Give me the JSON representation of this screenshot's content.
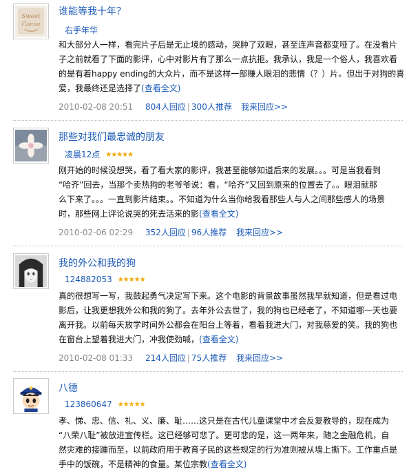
{
  "reviews": [
    {
      "title": "谁能等我十年？",
      "author": "右手年华",
      "stars": "",
      "lines": [
        "和大部分人一样，看完片子后是无止境的感动，哭肿了双眼，甚至连声音都变哑了。在没看片",
        "子之前就看了下面的影评，心中对影片有了那么一点抗拒。我承认，我是一个俗人，我喜欢看",
        "的是有着happy ending的大众片，而不是这样一部赚人眼泪的悲情（？）片。但出于对狗的喜",
        "爱，我最终还是选择了"
      ],
      "more": "(查看全文)",
      "date": "2010-02-08 20:51",
      "replies": "804人回应",
      "recommend": "300人推荐",
      "reply_link": "我来回应>>"
    },
    {
      "title": "那些对我们最忠诚的朋友",
      "author": "凌晨12点",
      "stars": "★★★★★",
      "lines": [
        "刚开始的时候没想哭，看了看大家的影评，我甚至能够知道后来的发展。。。可是当我看到",
        "“哈齐”回去，当那个卖热狗的老爷爷说：看，“哈齐”又回到原来的位置去了。。眼泪就那",
        "么下来了。。。一直到影片结束。。不知道为什么当你给我看那些人与人之间那些感人的场景",
        "时，那些网上评论说哭的死去活来的影"
      ],
      "more": "(查看全文)",
      "date": "2010-02-06 02:29",
      "replies": "352人回应",
      "recommend": "96人推荐",
      "reply_link": "我来回应>>"
    },
    {
      "title": "我的外公和我的狗",
      "author": "124882053",
      "stars": "★★★★★",
      "lines": [
        "真的很想写一写，我鼓起勇气决定写下来。这个电影的背景故事虽然我早就知道，但是看过电",
        "影后，让我更想我外公和我的狗了。去年外公去世了，我的狗也已经老了，不知道哪一天也要",
        "离开我。以前每天放学时间外公都会在阳台上等着，看着我进大门，对我慈爱的笑。我的狗也",
        "在窗台上望着我进大门，冲我使劲喊，"
      ],
      "more": "(查看全文)",
      "date": "2010-02-08 01:33",
      "replies": "214人回应",
      "recommend": "75人推荐",
      "reply_link": "我来回应>>"
    },
    {
      "title": "八德",
      "author": "123860647",
      "stars": "★★★★★",
      "lines": [
        "孝、悌、忠、信、礼、义、廉、耻……这只是在古代儿童课堂中才会反复教导的，现在成为",
        "“八荣八耻”被放进宣传栏。这已经够可悲了。更可悲的是，这一两年来，随之金融危机，自",
        "然灾难的接踵而至，以前政府用于教育子民的这些规定的行为准则被从墙上撕下。工作重点是",
        "手中的饭碗，不是精神的食量。某位宗教"
      ],
      "more": "(查看全文)",
      "date": "",
      "replies": "",
      "recommend": "",
      "reply_link": ""
    }
  ],
  "colors": {
    "link": "#1a59b7",
    "star": "#f0a800",
    "date": "#888888"
  },
  "icons": [
    "sweet-cocoa-avatar-icon",
    "flower-avatar-icon",
    "anime-girl-avatar-icon",
    "police-boy-avatar-icon"
  ]
}
